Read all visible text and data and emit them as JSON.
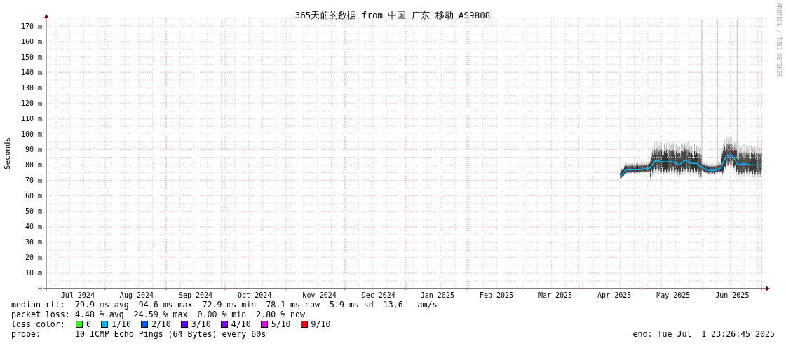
{
  "title": "365天前的数据 from 中国 广东 移动 AS9808",
  "credit": "RRDTOOL / TOBI OETIKER",
  "chart_data": {
    "type": "line",
    "ylabel": "Seconds",
    "ylim": [
      0,
      175
    ],
    "grid": true,
    "categories": [
      null,
      null,
      null,
      null,
      null,
      "Jul 2024",
      null,
      null,
      null,
      null,
      null,
      null,
      null,
      null,
      null,
      "Aug 2024",
      null,
      null,
      null,
      null,
      null,
      null,
      null,
      null,
      null,
      "Sep 2024",
      null,
      null,
      null,
      null,
      null,
      null,
      null,
      null,
      null,
      "Oct 2024",
      null,
      null,
      null,
      null,
      null,
      null,
      null,
      null,
      null,
      null,
      "Nov 2024",
      null,
      null,
      null,
      null,
      null,
      null,
      null,
      null,
      null,
      "Dec 2024",
      null,
      null,
      null,
      null,
      null,
      null,
      null,
      null,
      null,
      "Jan 2025",
      null,
      null,
      null,
      null,
      null,
      null,
      null,
      null,
      null,
      "Feb 2025",
      null,
      null,
      null,
      null,
      null,
      null,
      null,
      null,
      null,
      "Mar 2025",
      null,
      null,
      null,
      null,
      null,
      null,
      null,
      null,
      null,
      "Apr 2025",
      null,
      null,
      null,
      null,
      null,
      null,
      null,
      null,
      null,
      "May 2025",
      null,
      null,
      null,
      null,
      null,
      null,
      null,
      null,
      null,
      "Jun 2025",
      null,
      null,
      null,
      null,
      null
    ],
    "yticks": [
      {
        "value": 0,
        "label": "0"
      },
      {
        "value": 10,
        "label": "10 m"
      },
      {
        "value": 20,
        "label": "20 m"
      },
      {
        "value": 30,
        "label": "30 m"
      },
      {
        "value": 40,
        "label": "40 m"
      },
      {
        "value": 50,
        "label": "50 m"
      },
      {
        "value": 60,
        "label": "60 m"
      },
      {
        "value": 70,
        "label": "70 m"
      },
      {
        "value": 80,
        "label": "80 m"
      },
      {
        "value": 90,
        "label": "90 m"
      },
      {
        "value": 100,
        "label": "100 m"
      },
      {
        "value": 110,
        "label": "110 m"
      },
      {
        "value": 120,
        "label": "120 m"
      },
      {
        "value": 130,
        "label": "130 m"
      },
      {
        "value": 140,
        "label": "140 m"
      },
      {
        "value": 150,
        "label": "150 m"
      },
      {
        "value": 160,
        "label": "160 m"
      },
      {
        "value": 170,
        "label": "170 m"
      }
    ],
    "series": [
      {
        "color": "#00b8ff",
        "values": [
          null,
          null,
          null,
          null,
          null,
          null,
          null,
          null,
          null,
          null,
          null,
          null,
          null,
          null,
          null,
          null,
          null,
          null,
          null,
          null,
          null,
          null,
          null,
          null,
          null,
          null,
          null,
          null,
          null,
          null,
          null,
          null,
          null,
          null,
          null,
          null,
          null,
          null,
          null,
          null,
          null,
          null,
          null,
          null,
          null,
          null,
          null,
          null,
          null,
          null,
          null,
          null,
          null,
          null,
          null,
          null,
          null,
          null,
          null,
          null,
          null,
          null,
          null,
          null,
          null,
          null,
          null,
          null,
          null,
          null,
          null,
          null,
          null,
          null,
          null,
          null,
          null,
          null,
          null,
          null,
          null,
          null,
          null,
          null,
          null,
          null,
          null,
          null,
          null,
          null,
          null,
          null,
          null,
          null,
          null,
          null,
          null,
          73,
          77,
          77,
          77,
          77.5,
          78,
          83,
          82,
          82,
          82,
          80,
          83,
          81,
          81,
          78,
          76.5,
          76.5,
          78,
          86,
          86,
          80,
          81,
          80,
          80,
          80
        ]
      }
    ]
  },
  "stats": [
    {
      "label": "median rtt:",
      "text": "79.9 ms avg  94.6 ms max  72.9 ms min  78.1 ms now  5.9 ms sd  13.6   am/s"
    },
    {
      "label": "packet loss:",
      "text": "4.48 % avg  24.59 % max  0.00 % min  2.80 % now"
    }
  ],
  "loss_color": {
    "label": "loss color:",
    "items": [
      {
        "label": "0",
        "color": "#26ff00"
      },
      {
        "label": "1/10",
        "color": "#00b8ff"
      },
      {
        "label": "2/10",
        "color": "#0059ff"
      },
      {
        "label": "3/10",
        "color": "#5e00ff"
      },
      {
        "label": "4/10",
        "color": "#7e00ff"
      },
      {
        "label": "5/10",
        "color": "#dd00ff"
      },
      {
        "label": "9/10",
        "color": "#ff0000"
      }
    ]
  },
  "probe": {
    "label": "probe:",
    "text": "10 ICMP Echo Pings (64 Bytes) every 60s"
  },
  "end": "end: Tue Jul  1 23:26:45 2025"
}
